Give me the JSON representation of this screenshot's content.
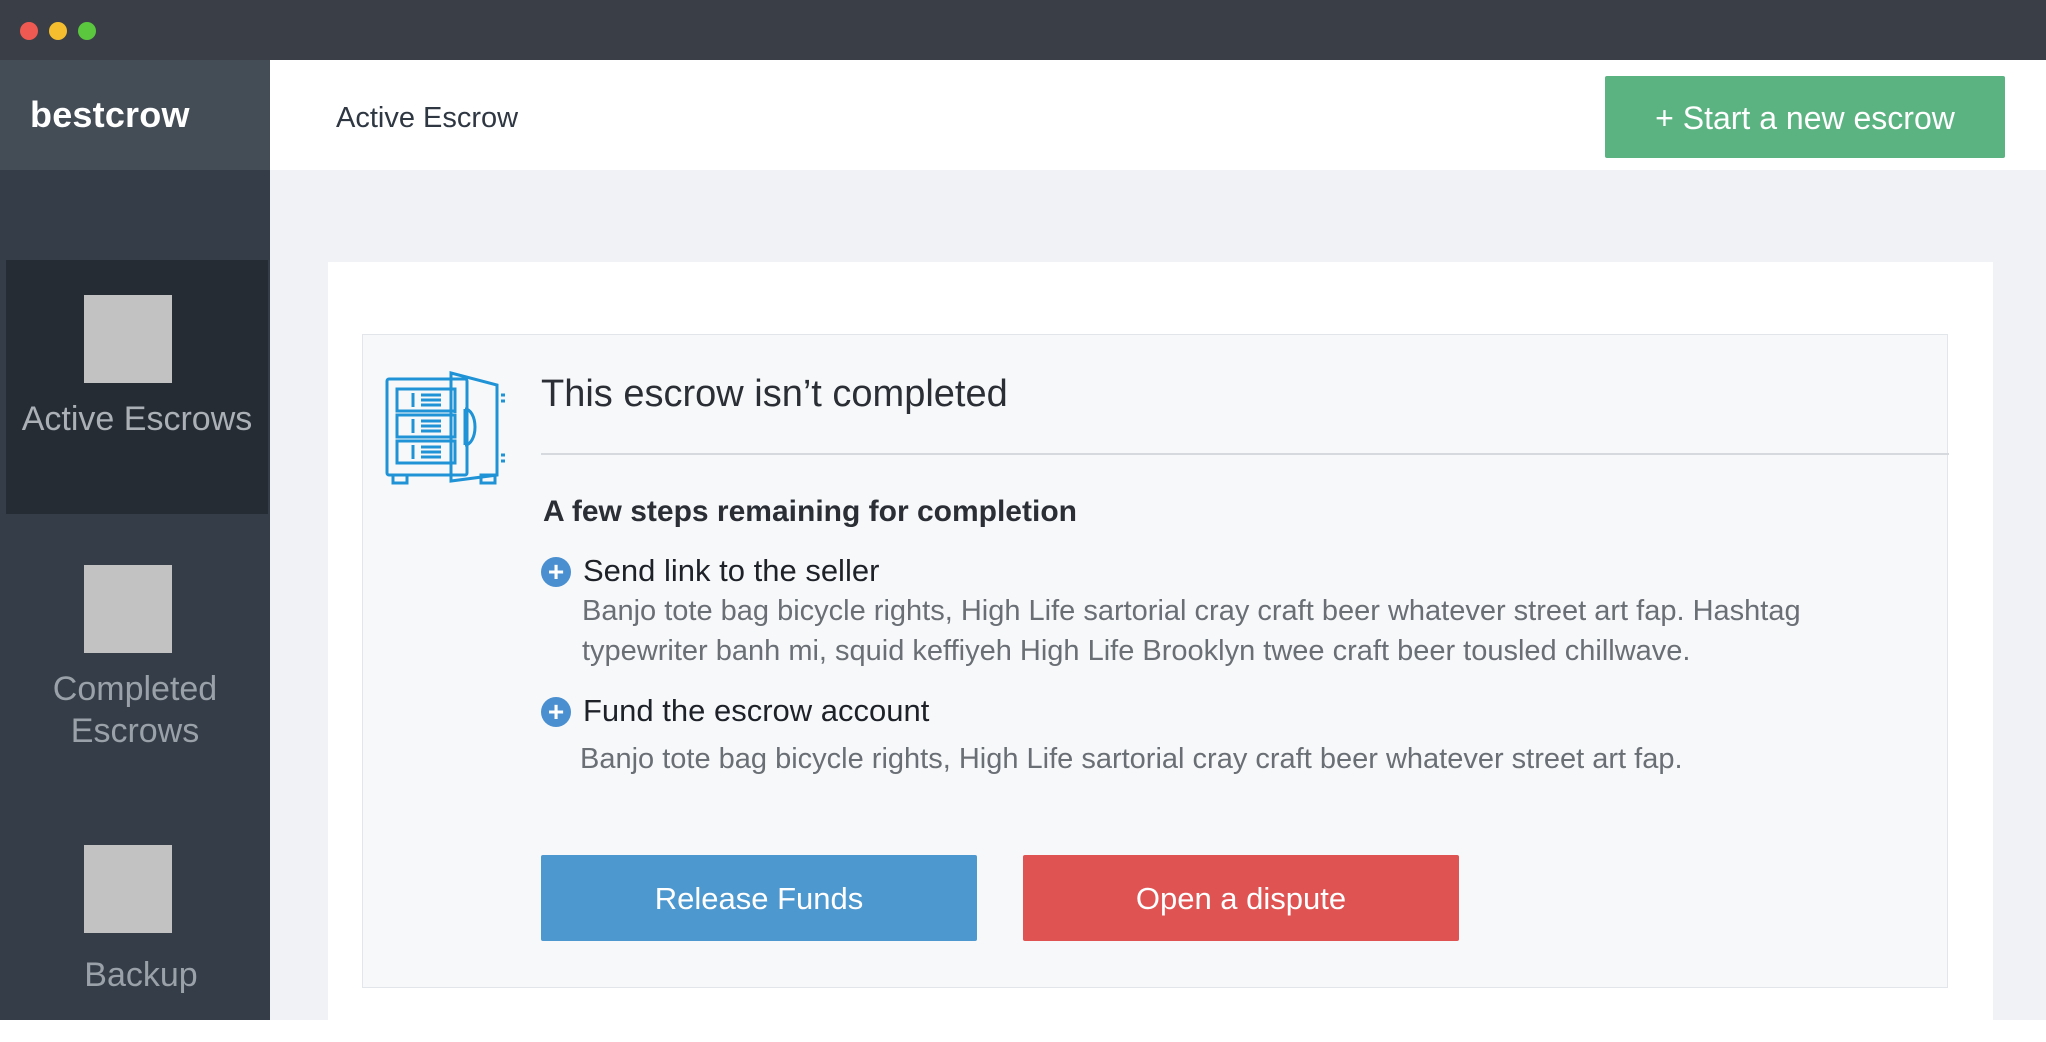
{
  "app": {
    "brand": "bestcrow"
  },
  "sidebar": {
    "items": [
      {
        "label": "Active Escrows",
        "active": true
      },
      {
        "label": "Completed Escrows",
        "active": false
      },
      {
        "label": "Backup",
        "active": false
      }
    ]
  },
  "header": {
    "title": "Active Escrow",
    "new_escrow_label": "+ Start a new escrow"
  },
  "status_card": {
    "icon": "safe-icon",
    "heading": "This escrow isn’t completed",
    "subheading": "A few steps remaining for completion",
    "steps": [
      {
        "title": "Send link to the seller",
        "description": "Banjo tote bag bicycle rights, High Life sartorial cray craft beer whatever street art fap. Hashtag typewriter banh mi, squid keffiyeh High Life Brooklyn twee craft beer tousled chillwave."
      },
      {
        "title": "Fund the escrow account",
        "description": "Banjo tote bag bicycle rights, High Life sartorial cray craft beer whatever street art fap."
      }
    ],
    "release_label": "Release Funds",
    "dispute_label": "Open a dispute"
  },
  "colors": {
    "sidebar_bg": "#353d48",
    "brand_bg": "#444c56",
    "active_item_bg": "#262c34",
    "new_escrow_btn": "#5bb382",
    "release_btn": "#4d98cf",
    "dispute_btn": "#e05353",
    "step_icon": "#4a8fd0"
  }
}
